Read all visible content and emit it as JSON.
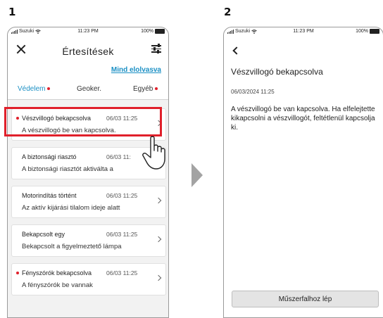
{
  "steps": [
    "1",
    "2"
  ],
  "statusbar": {
    "carrier": "Suzuki",
    "time": "11:23 PM",
    "battery": "100%"
  },
  "screen1": {
    "title": "Értesítések",
    "mark_all_read": "Mind elolvasva",
    "tabs": [
      {
        "label": "Védelem",
        "active": true,
        "unread_dot": true
      },
      {
        "label": "Geoker.",
        "active": false,
        "unread_dot": false
      },
      {
        "label": "Egyéb",
        "active": false,
        "unread_dot": true
      }
    ],
    "notifications": [
      {
        "title": "Vészvillogó bekapcsolva",
        "time": "06/03 11:25",
        "body": "A vészvillogó be van kapcsolva.",
        "unread": true
      },
      {
        "title": "A biztonsági riasztó",
        "time": "06/03 11:",
        "body": "A biztonsági riasztót aktiválta a",
        "unread": false
      },
      {
        "title": "Motorindítás történt",
        "time": "06/03 11:25",
        "body": "Az aktív kijárási tilalom ideje alatt",
        "unread": false
      },
      {
        "title": "Bekapcsolt egy",
        "time": "06/03 11:25",
        "body": "Bekapcsolt a figyelmeztető lámpa",
        "unread": false
      },
      {
        "title": "Fényszórók bekapcsolva",
        "time": "06/03 11:25",
        "body": "A fényszórók be vannak",
        "unread": true
      }
    ]
  },
  "screen2": {
    "title": "Vészvillogó bekapcsolva",
    "date": "06/03/2024 11:25",
    "body": "A vészvillogó be van kapcsolva. Ha elfelejtette kikapcsolni a vészvillogót, feltétlenül kapcsolja ki.",
    "button": "Műszerfalhoz lép"
  },
  "colors": {
    "accent": "#1a8fc4",
    "alert": "#e0202b",
    "arrow": "#a3a3a3"
  },
  "icons": [
    "close-icon",
    "filter-icon",
    "chevron-right-icon",
    "back-icon",
    "hand-pointer-icon",
    "signal-icon",
    "wifi-icon",
    "battery-icon"
  ]
}
